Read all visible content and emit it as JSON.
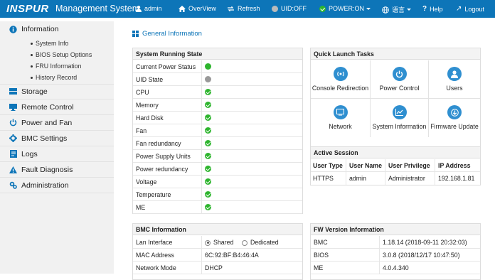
{
  "header": {
    "logo": "INSPUR",
    "title": "Management System",
    "user": "admin",
    "overview": "OverView",
    "refresh": "Refresh",
    "uid": "UID:OFF",
    "power": "POWER:ON",
    "language": "语言",
    "help": "Help",
    "logout": "Logout"
  },
  "sidebar": {
    "items": [
      {
        "label": "Information",
        "icon": "info-icon"
      },
      {
        "label": "Storage",
        "icon": "storage-icon"
      },
      {
        "label": "Remote Control",
        "icon": "monitor-icon"
      },
      {
        "label": "Power and Fan",
        "icon": "power-icon"
      },
      {
        "label": "BMC Settings",
        "icon": "settings-icon"
      },
      {
        "label": "Logs",
        "icon": "logs-icon"
      },
      {
        "label": "Fault Diagnosis",
        "icon": "warning-icon"
      },
      {
        "label": "Administration",
        "icon": "admin-gear-icon"
      }
    ],
    "subitems": [
      "System Info",
      "BIOS Setup Options",
      "FRU Information",
      "History Record"
    ]
  },
  "page_title": "General Information",
  "running_state": {
    "title": "System Running State",
    "rows": [
      {
        "label": "Current Power Status",
        "status": "green"
      },
      {
        "label": "UID State",
        "status": "gray"
      },
      {
        "label": "CPU",
        "status": "ok"
      },
      {
        "label": "Memory",
        "status": "ok"
      },
      {
        "label": "Hard Disk",
        "status": "ok"
      },
      {
        "label": "Fan",
        "status": "ok"
      },
      {
        "label": "Fan redundancy",
        "status": "ok"
      },
      {
        "label": "Power Supply Units",
        "status": "ok"
      },
      {
        "label": "Power redundancy",
        "status": "ok"
      },
      {
        "label": "Voltage",
        "status": "ok"
      },
      {
        "label": "Temperature",
        "status": "ok"
      },
      {
        "label": "ME",
        "status": "ok"
      }
    ]
  },
  "quick_launch": {
    "title": "Quick Launch Tasks",
    "items": [
      {
        "label": "Console Redirection",
        "icon": "console-redirection-icon"
      },
      {
        "label": "Power Control",
        "icon": "power-control-icon"
      },
      {
        "label": "Users",
        "icon": "users-icon"
      },
      {
        "label": "Network",
        "icon": "network-icon"
      },
      {
        "label": "System Information",
        "icon": "system-information-icon"
      },
      {
        "label": "Firmware Update",
        "icon": "firmware-update-icon"
      }
    ]
  },
  "active_session": {
    "title": "Active Session",
    "headers": [
      "User Type",
      "User Name",
      "User Privilege",
      "IP Address"
    ],
    "rows": [
      [
        "HTTPS",
        "admin",
        "Administrator",
        "192.168.1.81"
      ]
    ]
  },
  "bmc_info": {
    "title": "BMC Information",
    "lan_label": "Lan Interface",
    "lan_options": [
      "Shared",
      "Dedicated"
    ],
    "lan_selected": "Shared",
    "mac_label": "MAC Address",
    "mac_value": "6C:92:BF:B4:46:4A",
    "netmode_label": "Network Mode",
    "netmode_value": "DHCP"
  },
  "fw_version": {
    "title": "FW Version Information",
    "rows": [
      {
        "label": "BMC",
        "value": "1.18.14 (2018-09-11 20:32:03)"
      },
      {
        "label": "BIOS",
        "value": "3.0.8 (2018/12/17 10:47:50)"
      },
      {
        "label": "ME",
        "value": "4.0.4.340"
      }
    ]
  },
  "colors": {
    "topbar": "#0d75b8",
    "status_ok": "#2eb52e",
    "status_gray": "#999999",
    "launch_icon": "#2f8fd0"
  }
}
